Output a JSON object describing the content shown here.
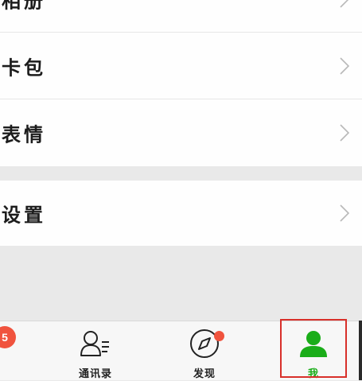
{
  "menu_group_1": {
    "items": [
      {
        "label": "相册"
      },
      {
        "label": "卡包"
      },
      {
        "label": "表情"
      }
    ]
  },
  "menu_group_2": {
    "items": [
      {
        "label": "设置"
      }
    ]
  },
  "tabbar": {
    "badge_count": "5",
    "tabs": [
      {
        "label": "通讯录",
        "icon": "contacts-icon"
      },
      {
        "label": "发现",
        "icon": "compass-icon",
        "has_dot": true
      },
      {
        "label": "我",
        "icon": "person-icon",
        "active": true
      }
    ],
    "active_color": "#1aad19",
    "badge_color": "#f0533e",
    "highlight_color": "#d8302a"
  }
}
